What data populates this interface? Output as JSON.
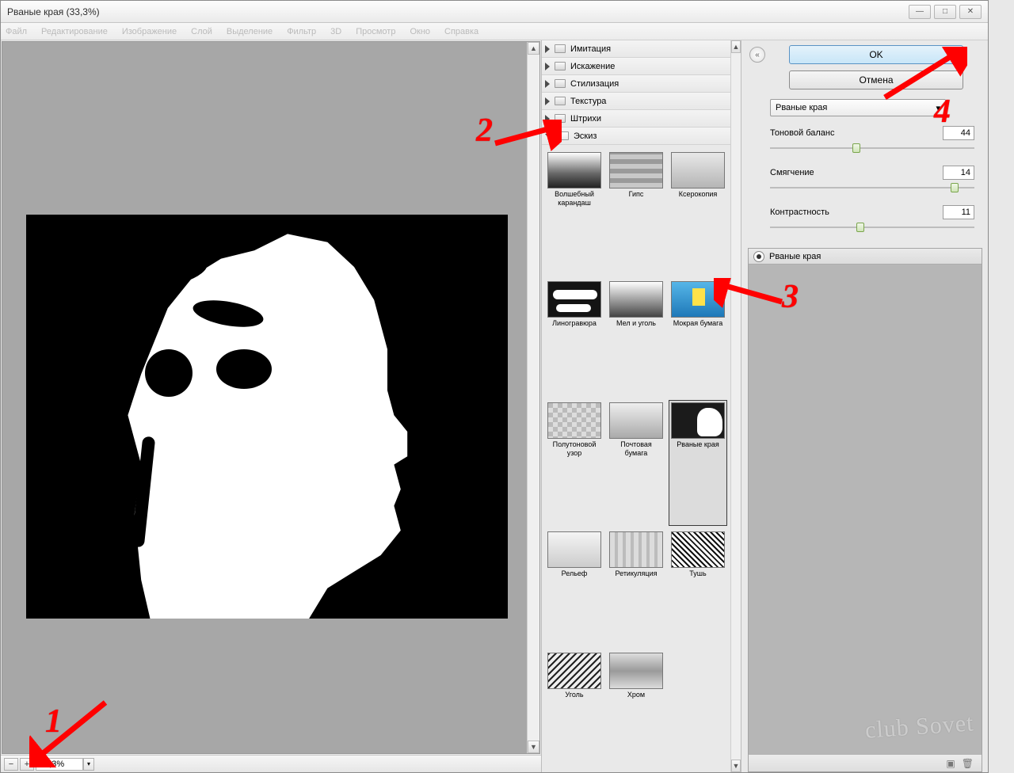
{
  "title": "Рваные края (33,3%)",
  "window_buttons": {
    "min": "—",
    "max": "□",
    "close": "✕"
  },
  "menus": [
    "Файл",
    "Редактирование",
    "Изображение",
    "Слой",
    "Выделение",
    "Фильтр",
    "3D",
    "Просмотр",
    "Окно",
    "Справка"
  ],
  "zoom": {
    "value": "33,3%",
    "minus": "−",
    "plus": "+",
    "caret": "▾"
  },
  "categories": [
    {
      "label": "Имитация",
      "open": false
    },
    {
      "label": "Искажение",
      "open": false
    },
    {
      "label": "Стилизация",
      "open": false
    },
    {
      "label": "Текстура",
      "open": false
    },
    {
      "label": "Штрихи",
      "open": false
    },
    {
      "label": "Эскиз",
      "open": true
    }
  ],
  "thumbs": [
    {
      "label": "Волшебный карандаш",
      "cls": "a"
    },
    {
      "label": "Гипс",
      "cls": "b"
    },
    {
      "label": "Ксерокопия",
      "cls": "c"
    },
    {
      "label": "Линогравюра",
      "cls": "d"
    },
    {
      "label": "Мел и уголь",
      "cls": "e"
    },
    {
      "label": "Мокрая бумага",
      "cls": "f"
    },
    {
      "label": "Полутоновой узор",
      "cls": "g"
    },
    {
      "label": "Почтовая бумага",
      "cls": "h"
    },
    {
      "label": "Рваные края",
      "cls": "i",
      "selected": true
    },
    {
      "label": "Рельеф",
      "cls": "j"
    },
    {
      "label": "Ретикуляция",
      "cls": "k"
    },
    {
      "label": "Тушь",
      "cls": "l"
    },
    {
      "label": "Уголь",
      "cls": "m"
    },
    {
      "label": "Хром",
      "cls": "n"
    }
  ],
  "buttons": {
    "ok": "OK",
    "cancel": "Отмена"
  },
  "filter_dropdown": "Рваные края",
  "params": {
    "p1": {
      "label": "Тоновой баланс",
      "value": "44",
      "pos": 0.42
    },
    "p2": {
      "label": "Смягчение",
      "value": "14",
      "pos": 0.92
    },
    "p3": {
      "label": "Контрастность",
      "value": "11",
      "pos": 0.44
    }
  },
  "history_item": "Рваные края",
  "history_foot": {
    "new": "▣",
    "trash": "🗑"
  },
  "collapse_glyph": "«",
  "scroll": {
    "up": "▲",
    "down": "▼"
  },
  "annotations": {
    "n1": "1",
    "n2": "2",
    "n3": "3",
    "n4": "4"
  },
  "watermark": "club Sovet"
}
